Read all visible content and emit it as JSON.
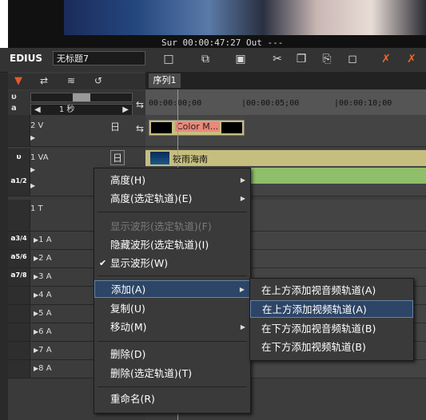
{
  "preview": {
    "timecode": "Sur 00:00:47:27     Out ---"
  },
  "app": {
    "name": "EDIUS",
    "project_title": "无标题7"
  },
  "toolbar": {
    "icons": [
      "new-project-icon",
      "open-project-icon",
      "save-icon",
      "cut-icon",
      "copy-icon",
      "paste-icon",
      "link-icon",
      "delete-icon",
      "ripple-delete-icon"
    ]
  },
  "timeline": {
    "sequence_tab": "序列1",
    "zoom": "1 秒",
    "ruler_ticks": [
      "00:00:00;00",
      "|00:00:05;00",
      "|00:00:10;00"
    ],
    "tracks": [
      {
        "label": "2 V",
        "clip": "Color M..."
      },
      {
        "label": "1 VA",
        "clip": "筱雨海南"
      },
      {
        "label": "1 T"
      },
      {
        "label": "1 A"
      },
      {
        "label": "2 A"
      },
      {
        "label": "3 A"
      },
      {
        "label": "4 A"
      },
      {
        "label": "5 A"
      },
      {
        "label": "6 A"
      },
      {
        "label": "7 A"
      },
      {
        "label": "8 A"
      }
    ],
    "stereo_badges": [
      "1/2",
      "3/4",
      "5/6",
      "7/8"
    ]
  },
  "context_menu": {
    "items": [
      {
        "label": "高度(H)",
        "submenu": true
      },
      {
        "label": "高度(选定轨道)(E)",
        "submenu": true
      },
      {
        "label": "显示波形(选定轨道)(F)",
        "disabled": true
      },
      {
        "label": "隐藏波形(选定轨道)(I)"
      },
      {
        "label": "显示波形(W)",
        "checked": true
      },
      {
        "label": "添加(A)",
        "submenu": true,
        "highlighted": true
      },
      {
        "label": "复制(U)"
      },
      {
        "label": "移动(M)",
        "submenu": true
      },
      {
        "label": "删除(D)"
      },
      {
        "label": "删除(选定轨道)(T)"
      },
      {
        "label": "重命名(R)"
      }
    ],
    "submenu_add": [
      "在上方添加视音频轨道(A)",
      "在上方添加视频轨道(A)",
      "在下方添加视音频轨道(B)",
      "在下方添加视频轨道(B)"
    ],
    "submenu_highlight_index": 1
  },
  "colors": {
    "video_clip": "#c6be7e",
    "audio_clip": "#8fbf6a",
    "menu_highlight": "#2d4566"
  }
}
